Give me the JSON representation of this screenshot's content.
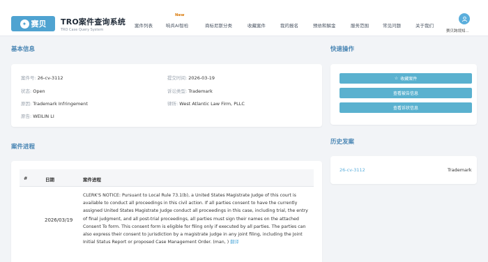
{
  "header": {
    "logo_text": "赛贝",
    "brand_title": "TRO案件查询系统",
    "brand_subtitle": "TRO Case Query System",
    "new_badge": "New",
    "nav": [
      "案件列表",
      "响兵AI智检",
      "商标尼斯分类",
      "收藏案件",
      "我的报名",
      "预依和解金",
      "服务范围",
      "常见问题",
      "关于我们"
    ],
    "user_name": "赛贝跨境知..."
  },
  "basic_info": {
    "title": "基本信息",
    "case_number_label": "案件号:",
    "case_number": "26-cv-3112",
    "filed_label": "提交时间:",
    "filed": "2026-03-19",
    "status_label": "状态:",
    "status": "Open",
    "type_label": "诉讼类型:",
    "type": "Trademark",
    "cause_label": "原因:",
    "cause": "Trademark Infringement",
    "lawfirm_label": "律所:",
    "lawfirm": "West Atlantic Law Firm, PLLC",
    "plaintiff_label": "原告:",
    "plaintiff": "WEILIN LI"
  },
  "quick_actions": {
    "title": "快速操作",
    "favorite": "收藏案件",
    "defendant_info": "查看被告信息",
    "complaint_info": "查看诉状信息"
  },
  "history": {
    "title": "历史发案",
    "items": [
      {
        "case": "26-cv-3112",
        "type": "Trademark"
      }
    ]
  },
  "progress": {
    "title": "案件进程",
    "col_num": "#",
    "col_date": "日期",
    "col_progress": "案件进程",
    "rows": [
      {
        "date": "2026/03/19",
        "text": "CLERK'S NOTICE: Pursuant to Local Rule 73.1(b), a United States Magistrate Judge of this court is available to conduct all proceedings in this civil action. If all parties consent to have the currently assigned United States Magistrate Judge conduct all proceedings in this case, including trial, the entry of final judgment, and all post-trial proceedings, all parties must sign their names on the attached Consent To form. This consent form is eligible for filing only if executed by all parties. The parties can also express their consent to jurisdiction by a magistrate judge in any joint filing, including the Joint Initial Status Report or proposed Case Management Order. (man, )",
        "more": "翻译"
      }
    ]
  }
}
